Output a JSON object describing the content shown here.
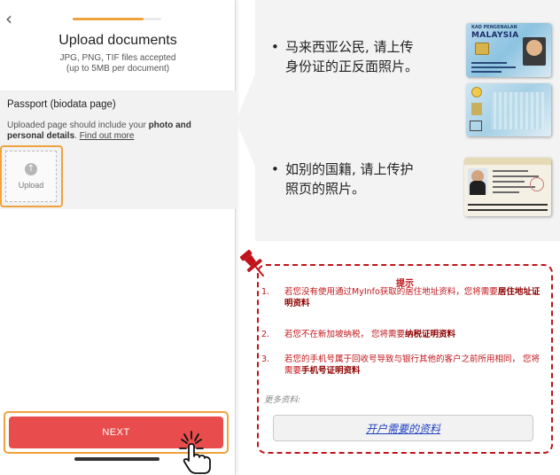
{
  "phone": {
    "back_icon": "chevron-left-icon",
    "progress_fraction": 0.8,
    "title": "Upload documents",
    "subtitle_line1": "JPG, PNG, TIF files accepted",
    "subtitle_line2": "(up to 5MB per document)",
    "doc_title": "Passport (biodata page)",
    "doc_desc_pre": "Uploaded page should include your ",
    "doc_desc_bold": "photo and personal details",
    "doc_desc_post": ". ",
    "doc_desc_link": "Find out more",
    "upload_label": "Upload",
    "next_label": "NEXT"
  },
  "info": {
    "bullet_symbol": "•",
    "malaysia_line1": "马来西亚公民, 请上传",
    "malaysia_line2": "身份证的正反面照片。",
    "foreign_line1": "如别的国籍, 请上传护",
    "foreign_line2": "照页的照片。",
    "card_front_header": "KAD PENGENALAN",
    "card_front_country": "MALAYSIA"
  },
  "tips": {
    "title": "提示",
    "items": [
      {
        "num": "1.",
        "pre": "若您没有使用通过MyInfo获取的居住地址资料，您将需要",
        "bold": "居住地址证明资料",
        "post": ""
      },
      {
        "num": "2.",
        "pre": "若您不在新加坡纳税， 您将需要",
        "bold": "纳税证明资料",
        "post": ""
      },
      {
        "num": "3.",
        "pre": "若您的手机号属于回收号导致与银行其他的客户之前所用相同， 您将需要",
        "bold": "手机号证明资料",
        "post": ""
      }
    ],
    "more_label": "更多资料:",
    "more_button": "开户需要的资料"
  },
  "colors": {
    "accent_orange": "#f0a23c",
    "next_red": "#e84c4c",
    "tips_red": "#c0141a",
    "link_blue": "#1f3fbf"
  }
}
